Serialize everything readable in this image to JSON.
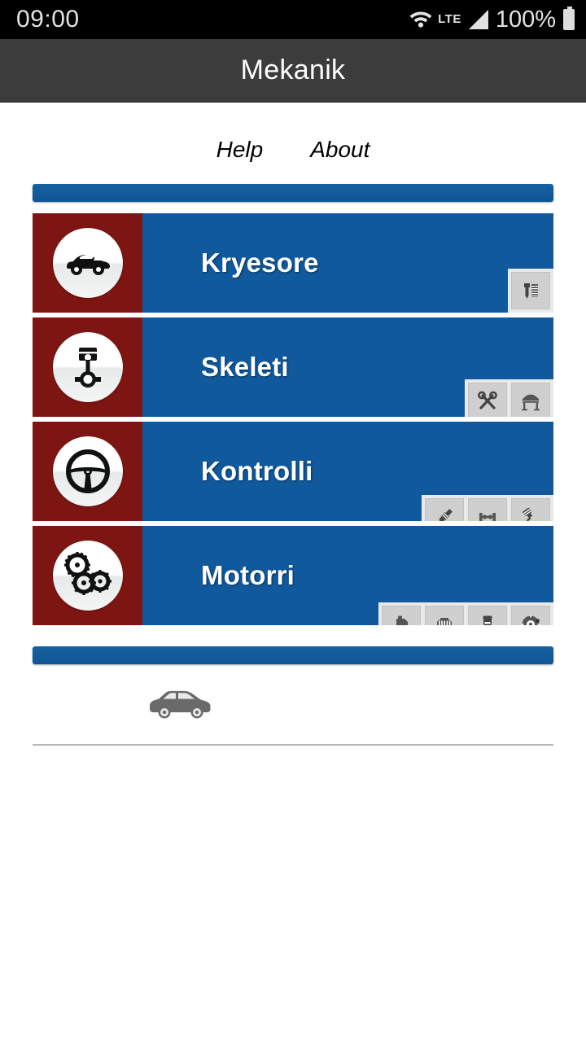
{
  "status_bar": {
    "time": "09:00",
    "network_label": "LTE",
    "battery_percent": "100%",
    "icons": [
      "wifi-icon",
      "signal-icon",
      "battery-icon"
    ]
  },
  "app_bar": {
    "title": "Mekanik"
  },
  "nav_links": [
    {
      "label": "Help",
      "name": "help-link"
    },
    {
      "label": "About",
      "name": "about-link"
    }
  ],
  "cards": [
    {
      "label": "Kryesore",
      "icon": "car-icon",
      "actions": [
        "bolt-nut-icon"
      ]
    },
    {
      "label": "Skeleti",
      "icon": "piston-icon",
      "actions": [
        "wrench-screwdriver-icon",
        "car-lift-icon"
      ]
    },
    {
      "label": "Kontrolli",
      "icon": "steering-wheel-icon",
      "actions": [
        "spark-plug-icon",
        "axle-icon",
        "ignition-coil-icon"
      ]
    },
    {
      "label": "Motorri",
      "icon": "gears-icon",
      "actions": [
        "oil-can-icon",
        "engine-block-icon",
        "mechanic-icon",
        "brake-disc-icon"
      ]
    }
  ],
  "footer": {
    "car_icon": "hatchback-car-icon"
  },
  "colors": {
    "status_bar_bg": "#000000",
    "app_bar_bg": "#3c3c3c",
    "card_red": "#7d1512",
    "card_blue": "#10599c",
    "divider_blue": "#11589e",
    "action_tray": "#e9e9e9",
    "action_button": "#cfcfcf",
    "footer_car": "#6a6a6a",
    "rule": "#b9b9b9"
  }
}
